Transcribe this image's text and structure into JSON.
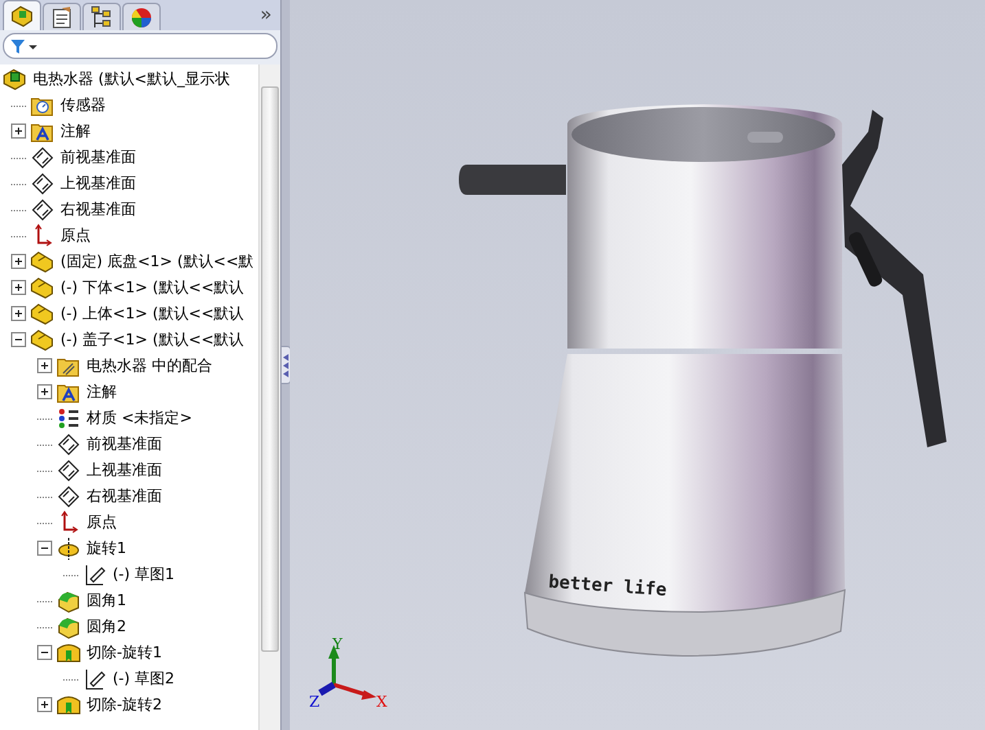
{
  "panel": {
    "tabs": [
      {
        "selected": true
      },
      {
        "selected": false
      },
      {
        "selected": false
      },
      {
        "selected": false
      }
    ],
    "more": "»"
  },
  "tree": {
    "root": {
      "kind": "assembly",
      "label": "电热水器  (默认<默认_显示状",
      "children": [
        {
          "kind": "sensor",
          "label": "传感器"
        },
        {
          "kind": "annotation",
          "label": "注解",
          "expanded": false
        },
        {
          "kind": "plane",
          "label": "前视基准面"
        },
        {
          "kind": "plane",
          "label": "上视基准面"
        },
        {
          "kind": "plane",
          "label": "右视基准面"
        },
        {
          "kind": "origin",
          "label": "原点"
        },
        {
          "kind": "part",
          "label": "(固定) 底盘<1> (默认<<默",
          "expanded": false
        },
        {
          "kind": "part",
          "label": "(-) 下体<1> (默认<<默认",
          "expanded": false
        },
        {
          "kind": "part",
          "label": "(-) 上体<1> (默认<<默认",
          "expanded": false
        },
        {
          "kind": "part",
          "label": "(-) 盖子<1> (默认<<默认",
          "expanded": true,
          "children": [
            {
              "kind": "mates",
              "label": "电热水器 中的配合",
              "expanded": false
            },
            {
              "kind": "annotation",
              "label": "注解",
              "expanded": false
            },
            {
              "kind": "material",
              "label": "材质 <未指定>"
            },
            {
              "kind": "plane",
              "label": "前视基准面"
            },
            {
              "kind": "plane",
              "label": "上视基准面"
            },
            {
              "kind": "plane",
              "label": "右视基准面"
            },
            {
              "kind": "origin",
              "label": "原点"
            },
            {
              "kind": "revolve",
              "label": "旋转1",
              "expanded": true,
              "children": [
                {
                  "kind": "sketch",
                  "label": "(-) 草图1"
                }
              ]
            },
            {
              "kind": "fillet",
              "label": "圆角1"
            },
            {
              "kind": "fillet",
              "label": "圆角2"
            },
            {
              "kind": "cut",
              "label": "切除-旋转1",
              "expanded": true,
              "children": [
                {
                  "kind": "sketch",
                  "label": "(-) 草图2"
                }
              ]
            },
            {
              "kind": "cut",
              "label": "切除-旋转2",
              "expanded": false
            }
          ]
        }
      ]
    }
  },
  "viewport": {
    "print": "better life",
    "axes": {
      "x": "X",
      "y": "Y",
      "z": "Z"
    }
  }
}
